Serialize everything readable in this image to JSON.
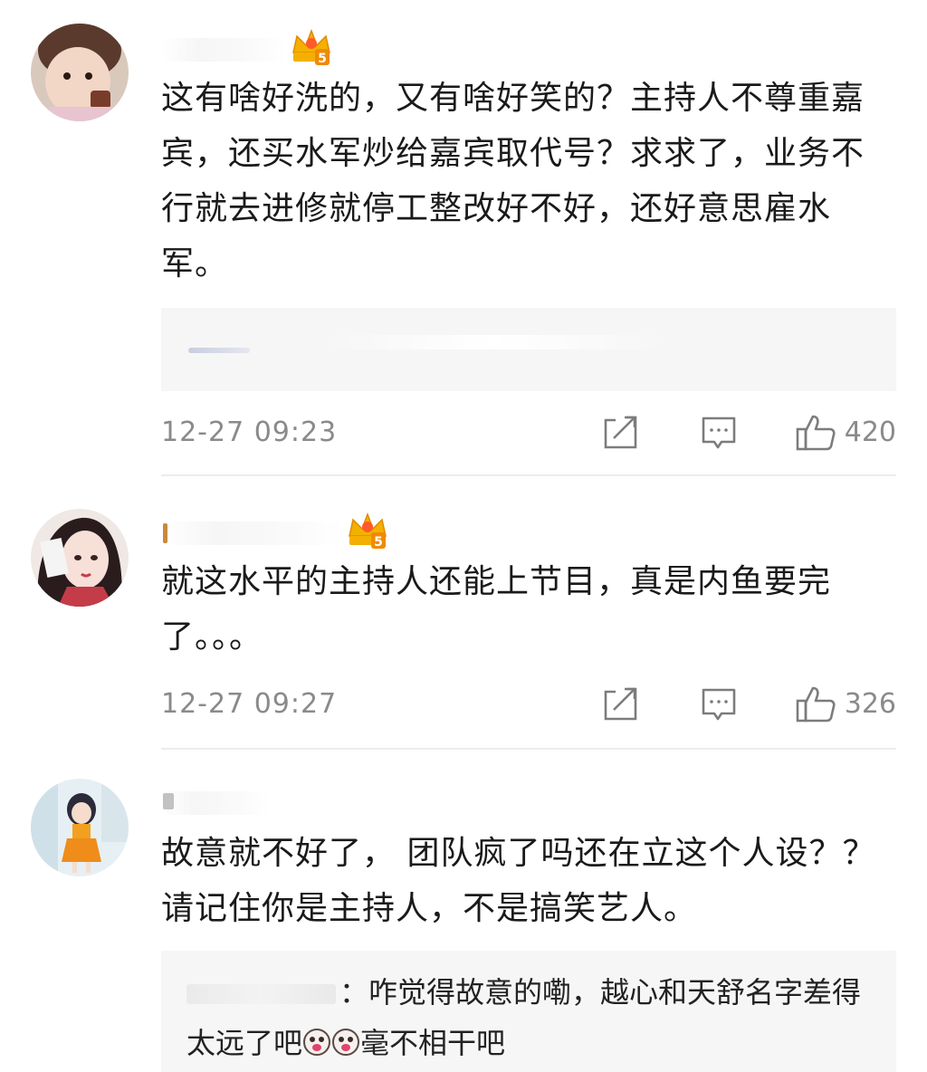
{
  "comments": [
    {
      "text": "这有啥好洗的，又有啥好笑的？主持人不尊重嘉宾，还买水军炒给嘉宾取代号？求求了，业务不行就去进修就停工整改好不好，还好意思雇水军。",
      "timestamp": "12-27 09:23",
      "likes": "420",
      "vip_level": "5"
    },
    {
      "text": "就这水平的主持人还能上节目，真是内鱼要完了。。。",
      "timestamp": "12-27 09:27",
      "likes": "326",
      "vip_level": "5"
    },
    {
      "text": "故意就不好了， 团队疯了吗还在立这个人设？？请记住你是主持人，不是搞笑艺人。",
      "reply": {
        "text_before": "：咋觉得故意的嘞，越心和天舒名字差得太远了吧",
        "text_after": "毫不相干吧"
      }
    }
  ],
  "icons": {
    "repost": "repost-icon",
    "comment": "comment-icon",
    "like": "thumbs-up-icon",
    "vip": "crown-vip-icon"
  },
  "colors": {
    "text": "#1a1a1a",
    "meta": "#8a8a8a",
    "vip": "#f0a020",
    "reply_bg": "#f6f6f6"
  }
}
